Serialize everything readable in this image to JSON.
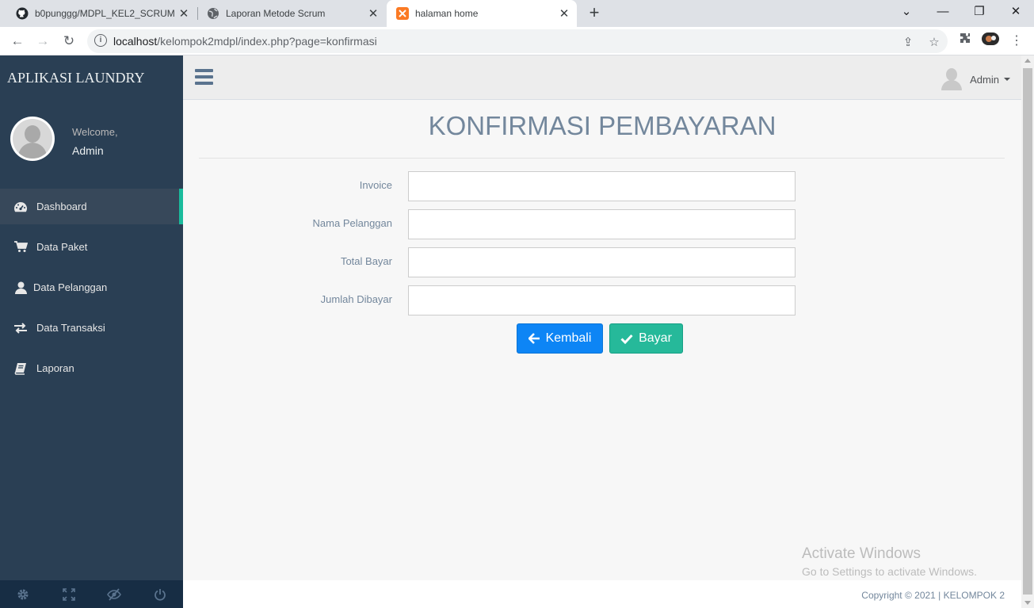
{
  "browser": {
    "tabs": [
      {
        "title": "b0punggg/MDPL_KEL2_SCRUM",
        "icon": "github-icon"
      },
      {
        "title": "Laporan Metode Scrum",
        "icon": "globe-icon"
      },
      {
        "title": "halaman home",
        "icon": "xampp-icon"
      }
    ],
    "url_host": "localhost",
    "url_path": "/kelompok2mdpl/index.php?page=konfirmasi"
  },
  "sidebar": {
    "brand": "APLIKASI LAUNDRY",
    "welcome": "Welcome,",
    "username": "Admin",
    "items": [
      {
        "label": "Dashboard",
        "icon": "dashboard-icon"
      },
      {
        "label": "Data Paket",
        "icon": "cart-icon"
      },
      {
        "label": "Data Pelanggan",
        "icon": "user-icon"
      },
      {
        "label": "Data Transaksi",
        "icon": "exchange-icon"
      },
      {
        "label": "Laporan",
        "icon": "book-icon"
      }
    ],
    "footer_icons": [
      "settings-icon",
      "fullscreen-icon",
      "hide-icon",
      "power-icon"
    ]
  },
  "topnav": {
    "user_label": "Admin"
  },
  "page": {
    "title": "KONFIRMASI PEMBAYARAN",
    "fields": [
      {
        "label": "Invoice",
        "value": ""
      },
      {
        "label": "Nama Pelanggan",
        "value": ""
      },
      {
        "label": "Total Bayar",
        "value": ""
      },
      {
        "label": "Jumlah Dibayar",
        "value": ""
      }
    ],
    "back_label": "Kembali",
    "pay_label": "Bayar"
  },
  "watermark": {
    "line1": "Activate Windows",
    "line2": "Go to Settings to activate Windows."
  },
  "footer": {
    "copyright": "Copyright © 2021 | KELOMPOK 2"
  },
  "colors": {
    "sidebar": "#2a3f54",
    "accent": "#1abb9c",
    "primary": "#0d85f5",
    "success": "#26b99a"
  }
}
